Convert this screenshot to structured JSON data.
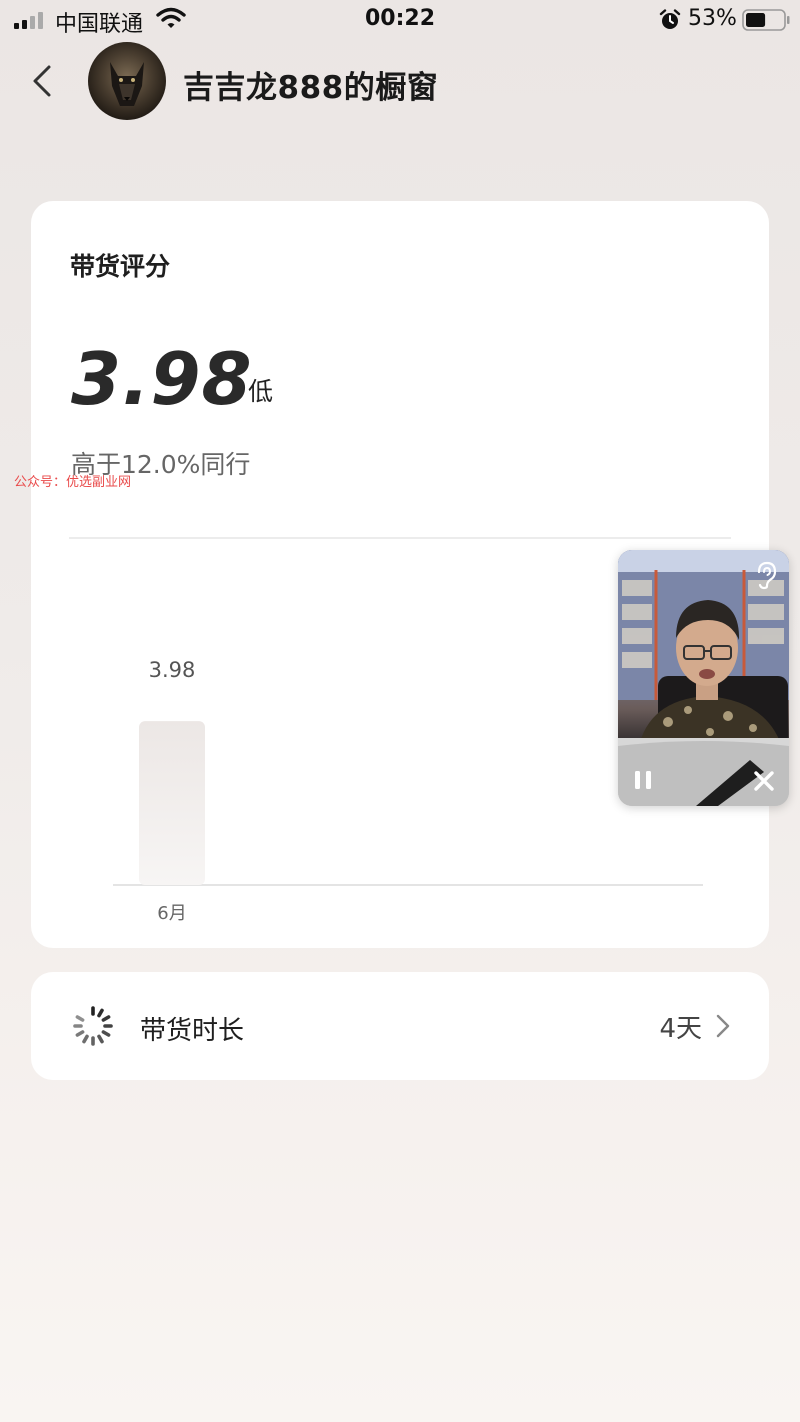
{
  "status_bar": {
    "carrier": "中国联通",
    "time": "00:22",
    "battery_percent": "53%",
    "battery_level": 0.53
  },
  "header": {
    "title": "吉吉龙888的橱窗"
  },
  "score_card": {
    "title": "带货评分",
    "score": "3.98",
    "level": "低",
    "peer_comparison": "高于12.0%同行",
    "watermark": "公众号：优选副业网"
  },
  "chart_data": {
    "type": "bar",
    "categories": [
      "6月"
    ],
    "values": [
      3.98
    ],
    "data_labels": [
      "3.98"
    ],
    "ylim": [
      0,
      5
    ],
    "grid": false
  },
  "duration_card": {
    "label": "带货时长",
    "value": "4天"
  },
  "colors": {
    "card_bg": "#ffffff",
    "page_bg": "#ebe6e4",
    "bar_fill": "#efebe9",
    "text_primary": "#1f1f1f",
    "text_secondary": "#666666",
    "watermark": "#e94b4b"
  },
  "icons": {
    "back": "chevron-left-icon",
    "duration": "spinner-icon",
    "more": "chevron-right-icon",
    "audio": "ear-icon",
    "pause": "pause-icon",
    "close": "close-icon"
  }
}
